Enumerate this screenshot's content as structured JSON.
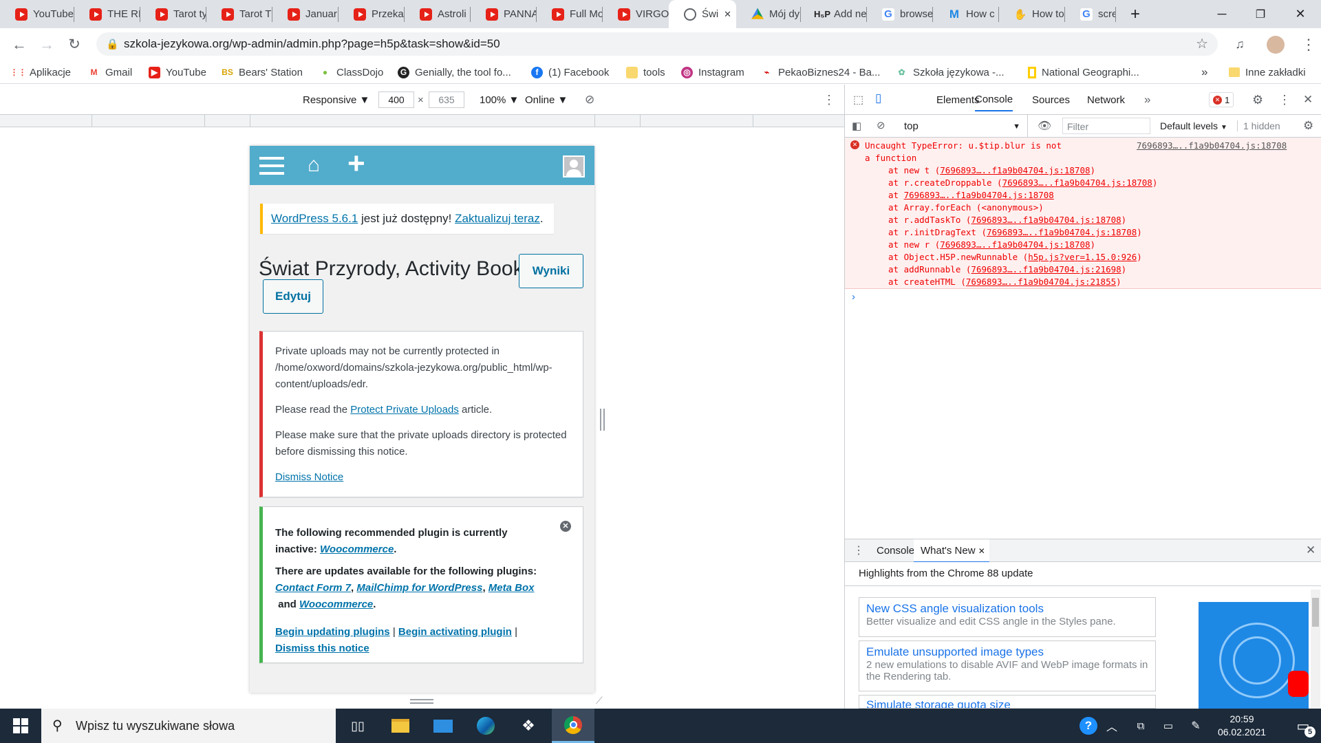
{
  "browser": {
    "tabs": [
      {
        "label": "YouTube",
        "icon": "youtube"
      },
      {
        "label": "THE RE",
        "icon": "youtube"
      },
      {
        "label": "Tarot ty",
        "icon": "youtube"
      },
      {
        "label": "Tarot T",
        "icon": "youtube"
      },
      {
        "label": "Januar",
        "icon": "youtube"
      },
      {
        "label": "Przeka",
        "icon": "youtube"
      },
      {
        "label": "Astroli",
        "icon": "youtube"
      },
      {
        "label": "PANNA",
        "icon": "youtube"
      },
      {
        "label": "Full Mo",
        "icon": "youtube"
      },
      {
        "label": "VIRGO",
        "icon": "youtube"
      },
      {
        "label": "Świ",
        "icon": "globe"
      },
      {
        "label": "Mój dy",
        "icon": "google-drive"
      },
      {
        "label": "Add ne",
        "icon": "h5p"
      },
      {
        "label": "browse",
        "icon": "google"
      },
      {
        "label": "How c",
        "icon": "m"
      },
      {
        "label": "How to",
        "icon": "hand"
      },
      {
        "label": "screen",
        "icon": "google"
      }
    ],
    "active_tab_close": "✕",
    "new_tab": "+",
    "url": "szkola-jezykowa.org/wp-admin/admin.php?page=h5p&task=show&id=50",
    "bookmarks": [
      {
        "label": "Aplikacje",
        "icon": "apps"
      },
      {
        "label": "Gmail",
        "icon": "gmail"
      },
      {
        "label": "YouTube",
        "icon": "youtube"
      },
      {
        "label": "Bears' Station",
        "icon": "bs"
      },
      {
        "label": "ClassDojo",
        "icon": "classdojo"
      },
      {
        "label": "Genially, the tool fo...",
        "icon": "genially"
      },
      {
        "label": "(1) Facebook",
        "icon": "facebook"
      },
      {
        "label": "tools",
        "icon": "folder"
      },
      {
        "label": "Instagram",
        "icon": "instagram"
      },
      {
        "label": "PekaoBiznes24 - Ba...",
        "icon": "pekao"
      },
      {
        "label": "Szkoła językowa -...",
        "icon": "leaf"
      },
      {
        "label": "National Geographi...",
        "icon": "natgeo"
      }
    ],
    "bookmarks_more": "»",
    "other_bookmarks": "Inne zakładki"
  },
  "device_toolbar": {
    "device": "Responsive",
    "width": "400",
    "times": "×",
    "height": "635",
    "zoom": "100%",
    "network": "Online"
  },
  "wp": {
    "update_notice": {
      "link1": "WordPress 5.6.1",
      "middle": " jest już dostępny! ",
      "link2": "Zaktualizuj teraz",
      "end": "."
    },
    "title": "Świat Przyrody, Activity Book",
    "results_button": "Wyniki",
    "edit_button": "Edytuj",
    "private_notice": {
      "p1": "Private uploads may not be currently protected in /home/oxword/domains/szkola-jezykowa.org/public_html/wp-content/uploads/edr.",
      "p2_before": "Please read the ",
      "p2_link": "Protect Private Uploads",
      "p2_after": " article.",
      "p3": "Please make sure that the private uploads directory is protected before dismissing this notice.",
      "dismiss": "Dismiss Notice"
    },
    "plugin_notice": {
      "p1_before": "The following recommended plugin is currently inactive: ",
      "p1_link": "Woocommerce",
      "p1_end": ".",
      "p2_before": "There are updates available for the following plugins: ",
      "p2_link1": "Contact Form 7",
      "p2_sep1": ", ",
      "p2_link2": "MailChimp for WordPress",
      "p2_sep2": ", ",
      "p2_link3": "Meta Box",
      "p2_and": " and ",
      "p2_link4": "Woocommerce",
      "p2_end": ".",
      "action1": "Begin updating plugins",
      "sep": " | ",
      "action2": "Begin activating plugin",
      "action3": "Dismiss this notice"
    }
  },
  "devtools": {
    "tabs": [
      "Elements",
      "Console",
      "Sources",
      "Network"
    ],
    "active_tab": "Console",
    "more": "»",
    "error_count": "1",
    "context": "top",
    "filter_placeholder": "Filter",
    "levels": "Default levels",
    "hidden": "1 hidden",
    "error": {
      "message": "Uncaught TypeError: u.$tip.blur is not a function",
      "source": "7696893…..f1a9b04704.js:18708",
      "stack": [
        {
          "pre": "at new t (",
          "link": "7696893…..f1a9b04704.js:18708",
          "post": ")"
        },
        {
          "pre": "at r.createDroppable (",
          "link": "7696893…..f1a9b04704.js:18708",
          "post": ")"
        },
        {
          "pre": "at ",
          "link": "7696893…..f1a9b04704.js:18708",
          "post": ""
        },
        {
          "pre": "at Array.forEach (<anonymous>)",
          "link": "",
          "post": ""
        },
        {
          "pre": "at r.addTaskTo (",
          "link": "7696893…..f1a9b04704.js:18708",
          "post": ")"
        },
        {
          "pre": "at r.initDragText (",
          "link": "7696893…..f1a9b04704.js:18708",
          "post": ")"
        },
        {
          "pre": "at new r (",
          "link": "7696893…..f1a9b04704.js:18708",
          "post": ")"
        },
        {
          "pre": "at Object.H5P.newRunnable (",
          "link": "h5p.js?ver=1.15.0:926",
          "post": ")"
        },
        {
          "pre": "at addRunnable (",
          "link": "7696893…..f1a9b04704.js:21698",
          "post": ")"
        },
        {
          "pre": "at createHTML (",
          "link": "7696893…..f1a9b04704.js:21855",
          "post": ")"
        }
      ]
    },
    "prompt": "›",
    "drawer": {
      "tabs": [
        "Console",
        "What's New"
      ],
      "heading": "Highlights from the Chrome 88 update",
      "cards": [
        {
          "title": "New CSS angle visualization tools",
          "desc": "Better visualize and edit CSS angle in the Styles pane."
        },
        {
          "title": "Emulate unsupported image types",
          "desc": "2 new emulations to disable AVIF and WebP image formats in the Rendering tab."
        },
        {
          "title": "Simulate storage quota size",
          "desc": ""
        }
      ]
    }
  },
  "taskbar": {
    "search_placeholder": "Wpisz tu wyszukiwane słowa",
    "time": "20:59",
    "date": "06.02.2021",
    "notifications": "5"
  },
  "colors": {
    "wp_admin_bar": "#52accc",
    "wp_link": "#0073aa",
    "error_red": "#d93025",
    "notice_red": "#dc3232",
    "notice_green": "#46b450",
    "notice_yellow": "#ffb900",
    "taskbar": "#1c2a3a"
  }
}
